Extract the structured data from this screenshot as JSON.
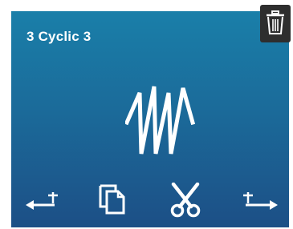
{
  "header": {
    "title": "3 Cyclic 3"
  },
  "icons": {
    "delete": "trash-icon",
    "pattern": "stitch-zigzag-icon",
    "insert_before": "insert-before-icon",
    "duplicate": "duplicate-icon",
    "cut": "scissors-icon",
    "insert_after": "insert-after-icon"
  },
  "colors": {
    "card_top": "#1a7fa9",
    "card_bottom": "#1c4f86",
    "trash_bg": "#2e2e2e",
    "icon": "#ffffff"
  }
}
